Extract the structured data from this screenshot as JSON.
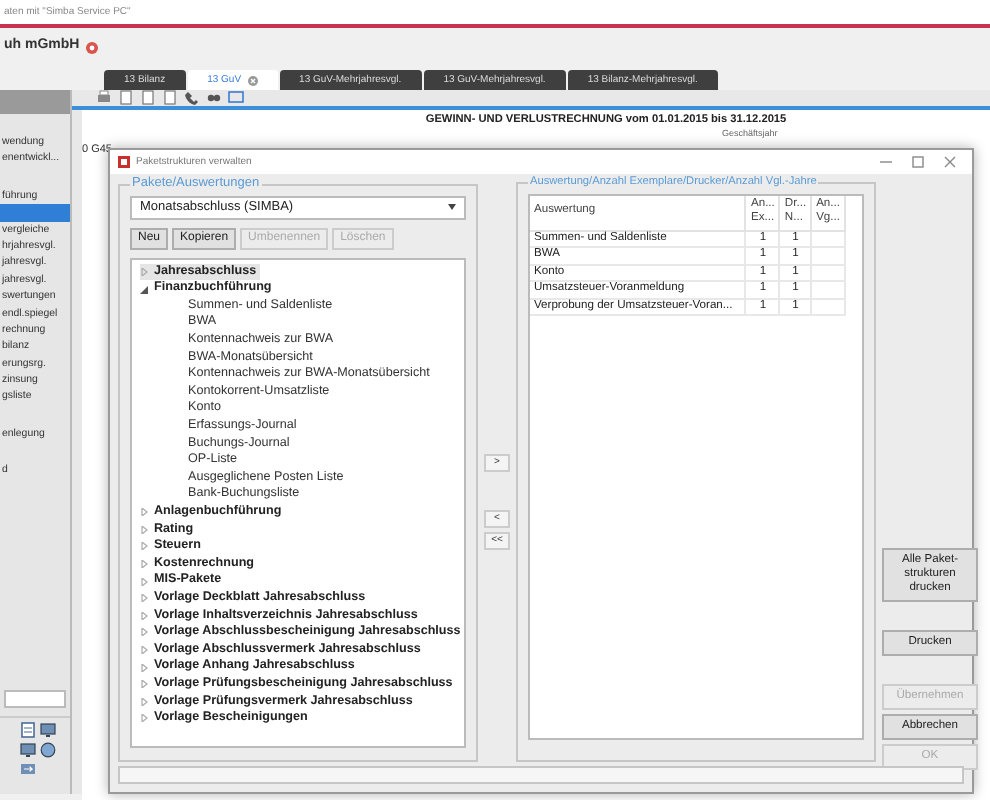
{
  "app": {
    "title_fragment": "aten mit \"Simba Service PC\"",
    "company": "uh mGmbH"
  },
  "tabs": [
    {
      "label": "13 Bilanz",
      "selected": false
    },
    {
      "label": "13 GuV",
      "selected": true
    },
    {
      "label": "13 GuV-Mehrjahresvgl.",
      "selected": false
    },
    {
      "label": "13 GuV-Mehrjahresvgl.",
      "selected": false
    },
    {
      "label": "13 Bilanz-Mehrjahresvgl.",
      "selected": false
    }
  ],
  "sidebar": {
    "groups": [
      [
        {
          "label": "wendung",
          "selected": false
        },
        {
          "label": "enentwickl...",
          "selected": false
        }
      ],
      [
        {
          "label": "führung",
          "selected": false
        },
        {
          "selected": true
        },
        {
          "label": "vergleiche",
          "selected": false
        },
        {
          "label": "hrjahresvgl.",
          "selected": false
        },
        {
          "label": "jahresvgl.",
          "selected": false
        },
        {
          "label": "jahresvgl.",
          "selected": false
        },
        {
          "label": "swertungen",
          "selected": false
        },
        {
          "label": "endl.spiegel",
          "selected": false
        },
        {
          "label": "rechnung",
          "selected": false
        },
        {
          "label": "bilanz",
          "selected": false
        },
        {
          "label": "erungsrg.",
          "selected": false
        },
        {
          "label": "zinsung",
          "selected": false
        },
        {
          "label": "gsliste",
          "selected": false
        }
      ],
      [
        {
          "label": "enlegung",
          "selected": false
        }
      ],
      [
        {
          "label": "d",
          "selected": false
        }
      ]
    ]
  },
  "report": {
    "title": "GEWINN- UND VERLUSTRECHNUNG  vom 01.01.2015 bis 31.12.2015",
    "column_header": "Geschäftsjahr",
    "row_label": "0 G45"
  },
  "dialog": {
    "title": "Paketstrukturen verwalten",
    "packages": {
      "label": "Pakete/Auswertungen",
      "dropdown": "Monatsabschluss (SIMBA)",
      "buttons": [
        {
          "label": "Neu",
          "disabled": false
        },
        {
          "label": "Kopieren",
          "disabled": false
        },
        {
          "label": "Umbenennen",
          "disabled": true
        },
        {
          "label": "Löschen",
          "disabled": true
        }
      ],
      "tree": [
        {
          "label": "Jahresabschluss",
          "expanded": false,
          "selected": true
        },
        {
          "label": "Finanzbuchführung",
          "expanded": true,
          "selected": false,
          "children": [
            {
              "label": "Summen- und Saldenliste"
            },
            {
              "label": "BWA"
            },
            {
              "label": "Kontennachweis zur BWA"
            },
            {
              "label": "BWA-Monatsübersicht"
            },
            {
              "label": "Kontennachweis zur BWA-Monatsübersicht"
            },
            {
              "label": "Kontokorrent-Umsatzliste"
            },
            {
              "label": "Konto"
            },
            {
              "label": "Erfassungs-Journal"
            },
            {
              "label": "Buchungs-Journal"
            },
            {
              "label": "OP-Liste"
            },
            {
              "label": "Ausgeglichene Posten Liste"
            },
            {
              "label": "Bank-Buchungsliste"
            }
          ]
        },
        {
          "label": "Anlagenbuchführung",
          "expanded": false,
          "selected": false
        },
        {
          "label": "Rating",
          "expanded": false,
          "selected": false
        },
        {
          "label": "Steuern",
          "expanded": false,
          "selected": false
        },
        {
          "label": "Kostenrechnung",
          "expanded": false,
          "selected": false
        },
        {
          "label": "MIS-Pakete",
          "expanded": false,
          "selected": false
        },
        {
          "label": "Vorlage Deckblatt Jahresabschluss",
          "expanded": false,
          "selected": false
        },
        {
          "label": "Vorlage Inhaltsverzeichnis Jahresabschluss",
          "expanded": false,
          "selected": false
        },
        {
          "label": "Vorlage Abschlussbescheinigung Jahresabschluss",
          "expanded": false,
          "selected": false
        },
        {
          "label": "Vorlage Abschlussvermerk Jahresabschluss",
          "expanded": false,
          "selected": false
        },
        {
          "label": "Vorlage Anhang Jahresabschluss",
          "expanded": false,
          "selected": false
        },
        {
          "label": "Vorlage Prüfungsbescheinigung Jahresabschluss",
          "expanded": false,
          "selected": false
        },
        {
          "label": "Vorlage Prüfungsvermerk Jahresabschluss",
          "expanded": false,
          "selected": false
        },
        {
          "label": "Vorlage Bescheinigungen",
          "expanded": false,
          "selected": false
        }
      ]
    },
    "transfer_buttons": [
      ">",
      "<",
      "<<"
    ],
    "reports": {
      "label": "Auswertung/Anzahl Exemplare/Drucker/Anzahl Vgl.-Jahre",
      "columns": [
        "Auswertung",
        "An... Ex...",
        "Dr... N...",
        "An... Vg..."
      ],
      "rows": [
        [
          "Summen- und Saldenliste",
          "1",
          "1"
        ],
        [
          "BWA",
          "1",
          "1"
        ],
        [
          "Konto",
          "1",
          "1"
        ],
        [
          "Umsatzsteuer-Voranmeldung",
          "1",
          "1"
        ],
        [
          "Verprobung der Umsatzsteuer-Voran...",
          "1",
          "1"
        ]
      ]
    },
    "side_buttons": [
      {
        "label": "Alle Paket-strukturen drucken",
        "disabled": false
      },
      {
        "label": "Drucken",
        "disabled": false
      },
      {
        "label": "Übernehmen",
        "disabled": true
      },
      {
        "label": "Abbrechen",
        "disabled": false
      },
      {
        "label": "OK",
        "disabled": true
      }
    ]
  }
}
